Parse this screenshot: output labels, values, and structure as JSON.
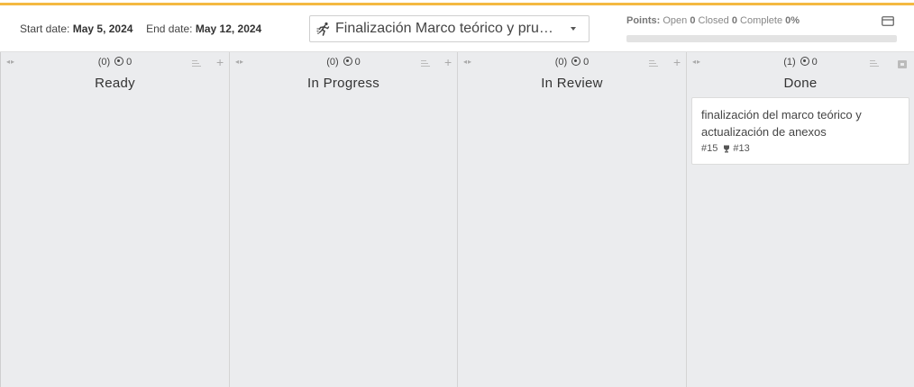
{
  "header": {
    "start_label": "Start date:",
    "start_value": "May 5, 2024",
    "end_label": "End date:",
    "end_value": "May 12, 2024",
    "sprint_icon": "runner-icon",
    "sprint_name": "Finalización Marco teórico y pruebas",
    "points_label": "Points:",
    "open_label": "Open",
    "open_value": "0",
    "closed_label": "Closed",
    "closed_value": "0",
    "complete_label": "Complete",
    "complete_value": "0%",
    "progress_fraction": 0,
    "accent_color": "#f4b942"
  },
  "columns": [
    {
      "count": "(0)",
      "estimate": "0",
      "title": "Ready"
    },
    {
      "count": "(0)",
      "estimate": "0",
      "title": "In Progress"
    },
    {
      "count": "(0)",
      "estimate": "0",
      "title": "In Review"
    },
    {
      "count": "(1)",
      "estimate": "0",
      "title": "Done"
    }
  ],
  "cards": [
    {
      "title": "finalización del marco teórico y actualización de anexos",
      "number": "#15",
      "milestone_icon": "trophy-icon",
      "milestone": "#13"
    }
  ]
}
